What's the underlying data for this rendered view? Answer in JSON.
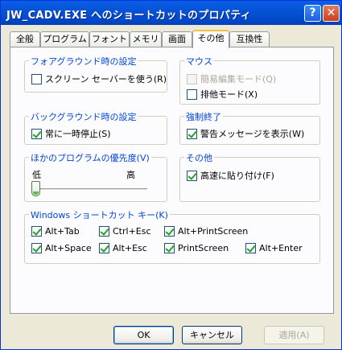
{
  "window": {
    "title": "JW_CADV.EXE へのショートカットのプロパティ",
    "help_glyph": "?",
    "close_glyph": "✕"
  },
  "tabs": [
    "全般",
    "プログラム",
    "フォント",
    "メモリ",
    "画面",
    "その他",
    "互換性"
  ],
  "active_tab": "その他",
  "foreground": {
    "title": "フォアグラウンド時の設定",
    "screensaver": {
      "label": "スクリーン セーバーを使う(R)",
      "checked": false
    }
  },
  "mouse": {
    "title": "マウス",
    "quickedit": {
      "label": "簡易編集モード(Q)",
      "checked": false,
      "enabled": false
    },
    "exclusive": {
      "label": "排他モード(X)",
      "checked": false
    }
  },
  "background": {
    "title": "バックグラウンド時の設定",
    "suspend": {
      "label": "常に一時停止(S)",
      "checked": true
    }
  },
  "terminate": {
    "title": "強制終了",
    "warn": {
      "label": "警告メッセージを表示(W)",
      "checked": true
    }
  },
  "priority": {
    "title": "ほかのプログラムの優先度(V)",
    "low": "低",
    "high": "高",
    "level": 0
  },
  "other": {
    "title": "その他",
    "fastpaste": {
      "label": "高速に貼り付け(F)",
      "checked": true
    }
  },
  "shortcut_keys": {
    "title": "Windows ショートカット キー(K)",
    "keys": [
      {
        "label": "Alt+Tab",
        "checked": true
      },
      {
        "label": "Ctrl+Esc",
        "checked": true
      },
      {
        "label": "Alt+PrintScreen",
        "checked": true
      },
      {
        "label": "Alt+Space",
        "checked": true
      },
      {
        "label": "Alt+Esc",
        "checked": true
      },
      {
        "label": "PrintScreen",
        "checked": true
      },
      {
        "label": "Alt+Enter",
        "checked": true
      }
    ]
  },
  "buttons": {
    "ok": "OK",
    "cancel": "キャンセル",
    "apply": "適用(A)"
  }
}
